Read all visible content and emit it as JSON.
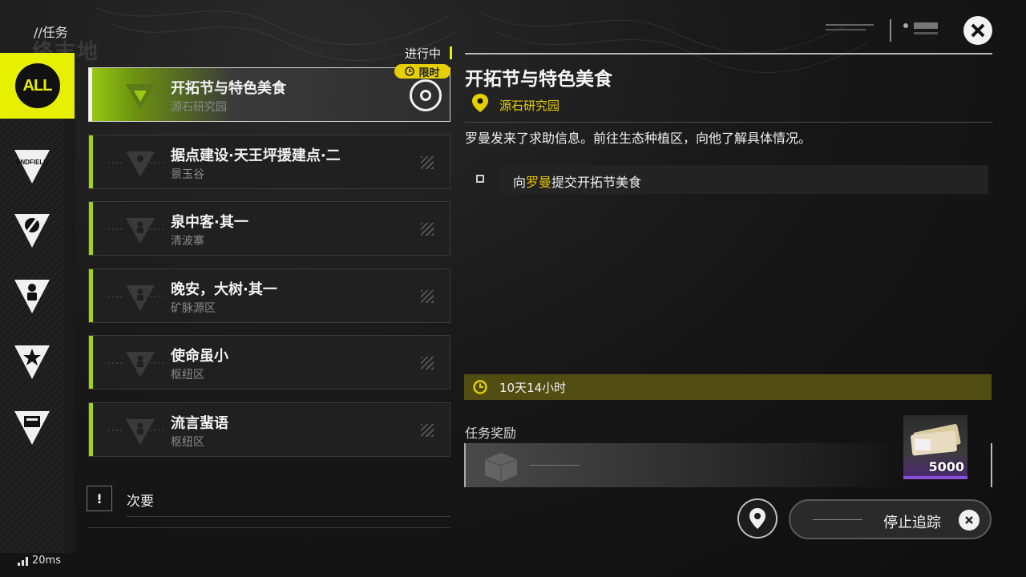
{
  "header": {
    "title": "//任务",
    "logo_text": "终末地"
  },
  "sidebar": {
    "categories": [
      {
        "name": "all",
        "label": "ALL",
        "active": true
      },
      {
        "name": "endfield",
        "icon": "endfield-icon"
      },
      {
        "name": "side",
        "icon": "compass-icon"
      },
      {
        "name": "character",
        "icon": "person-icon"
      },
      {
        "name": "event",
        "icon": "star-icon"
      },
      {
        "name": "misc",
        "icon": "calendar-icon"
      }
    ],
    "endfield_label": "ENDFIELD"
  },
  "list": {
    "status_tag": "进行中",
    "limited_label": "限时",
    "quests": [
      {
        "name": "开拓节与特色美食",
        "location": "源石研究园",
        "selected": true
      },
      {
        "name": "据点建设·天王坪援建点·二",
        "location": "景玉谷"
      },
      {
        "name": "泉中客·其一",
        "location": "清波寨"
      },
      {
        "name": "晚安，大树·其一",
        "location": "矿脉源区"
      },
      {
        "name": "使命虽小",
        "location": "枢纽区"
      },
      {
        "name": "流言蜚语",
        "location": "枢纽区"
      }
    ],
    "minor_label": "次要",
    "minor_icon": "!"
  },
  "detail": {
    "title": "开拓节与特色美食",
    "location": "源石研究园",
    "description": "罗曼发来了求助信息。前往生态种植区，向他了解具体情况。",
    "objective": {
      "prefix": "向",
      "highlight": "罗曼",
      "suffix": "提交开拓节美食"
    },
    "timer": "10天14小时",
    "reward_label": "任务奖励",
    "reward_amount": "5000",
    "stop_tracking": "停止追踪"
  },
  "status": {
    "ping": "20ms"
  },
  "colors": {
    "accent": "#e6f000",
    "limited": "#e6d000",
    "highlight": "#e6c200",
    "rare": "#8a4fd8"
  }
}
